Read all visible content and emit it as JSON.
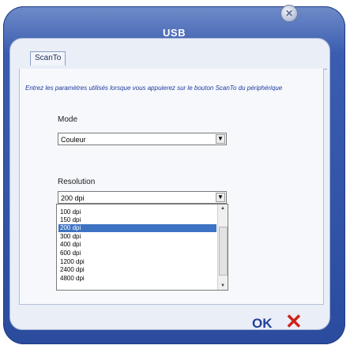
{
  "window": {
    "title": "USB"
  },
  "tabs": [
    {
      "label": "ScanTo",
      "active": true
    }
  ],
  "instructions": "Entrez les paramètres utilisés lorsque vous appuierez sur le bouton ScanTo du périphérique",
  "mode": {
    "label": "Mode",
    "value": "Couleur"
  },
  "resolution": {
    "label": "Resolution",
    "value": "200 dpi",
    "options": [
      "100 dpi",
      "150 dpi",
      "200 dpi",
      "300 dpi",
      "400 dpi",
      "600 dpi",
      "1200 dpi",
      "2400 dpi",
      "4800 dpi"
    ],
    "selected_index": 2
  },
  "buttons": {
    "ok_label": "OK",
    "cancel_label": "✕"
  },
  "colors": {
    "frame": "#3b5db0",
    "selection": "#3d73c2",
    "ok": "#1f3f99",
    "cancel": "#d0201a"
  }
}
